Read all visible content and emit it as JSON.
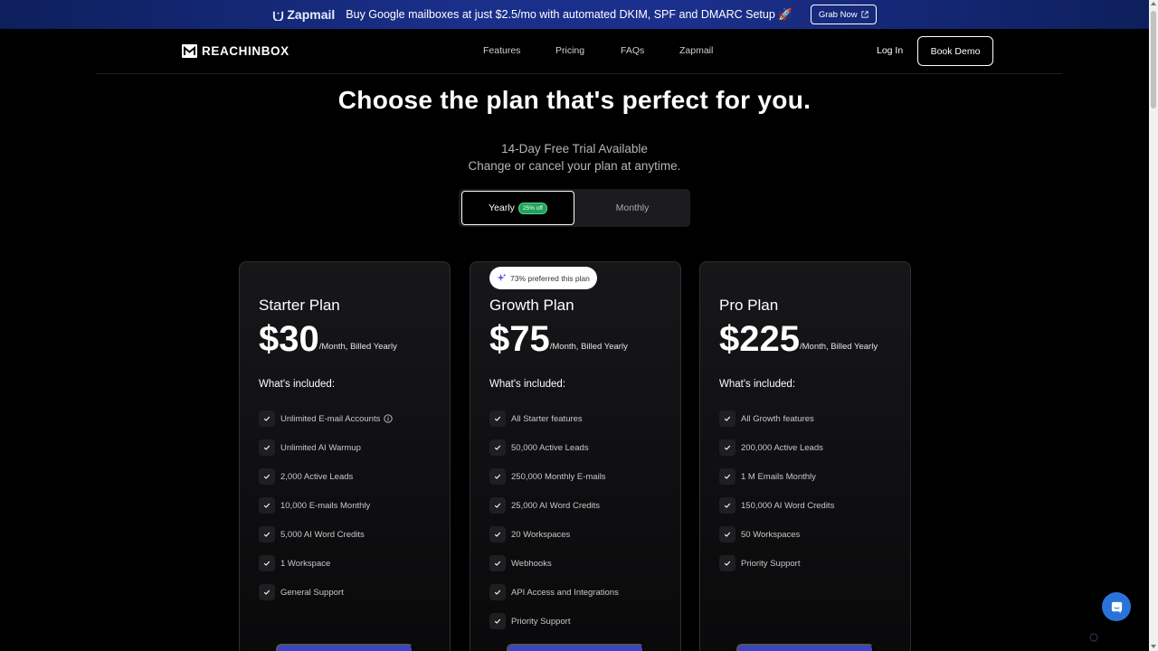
{
  "banner": {
    "brand": "Zapmail",
    "text": "Buy Google mailboxes at just $2.5/mo with automated DKIM, SPF and DMARC Setup 🚀",
    "cta": "Grab Now"
  },
  "nav": {
    "logo": "REACHINBOX",
    "links": [
      "Features",
      "Pricing",
      "FAQs",
      "Zapmail"
    ],
    "login": "Log In",
    "demo": "Book Demo"
  },
  "hero": {
    "title": "Choose the plan that's perfect for you.",
    "sub1": "14-Day Free Trial Available",
    "sub2": "Change or cancel your plan at anytime."
  },
  "toggle": {
    "yearly": "Yearly",
    "discount": "25% off",
    "monthly": "Monthly",
    "selected": "Yearly"
  },
  "plans": [
    {
      "name": "Starter Plan",
      "price": "$30",
      "suffix": "/Month, Billed Yearly",
      "included": "What's included:",
      "features": [
        "Unlimited E-mail Accounts",
        "Unlimited AI Warmup",
        "2,000 Active Leads",
        "10,000 E-mails Monthly",
        "5,000 AI Word Credits",
        "1 Workspace",
        "General Support"
      ]
    },
    {
      "name": "Growth Plan",
      "badge": "73% preferred this plan",
      "price": "$75",
      "suffix": "/Month, Billed Yearly",
      "included": "What's included:",
      "features": [
        "All Starter features",
        "50,000 Active Leads",
        "250,000 Monthly E-mails",
        "25,000 AI Word Credits",
        "20 Workspaces",
        "Webhooks",
        "API Access and Integrations",
        "Priority Support"
      ]
    },
    {
      "name": "Pro Plan",
      "price": "$225",
      "suffix": "/Month, Billed Yearly",
      "included": "What's included:",
      "features": [
        "All Growth features",
        "200,000 Active Leads",
        "1 M Emails Monthly",
        "150,000 AI Word Credits",
        "50 Workspaces",
        "Priority Support"
      ]
    }
  ],
  "colors": {
    "accent": "#3b44c6",
    "discount": "#1fa45a",
    "chat": "#2a73d9"
  }
}
